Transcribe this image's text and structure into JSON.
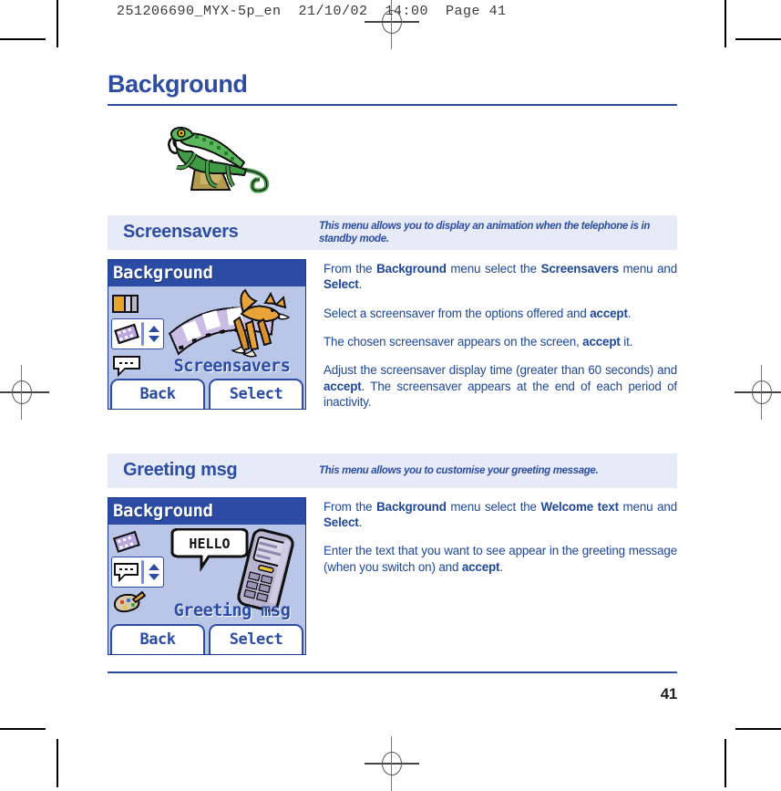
{
  "print_marks": {
    "slug_line": "251206690_MYX-5p_en  21/10/02  14:00  Page 41"
  },
  "page": {
    "title": "Background",
    "page_number": "41",
    "illustration": "chameleon-illustration"
  },
  "sections": [
    {
      "id": "screensavers",
      "heading": "Screensavers",
      "description": "This menu allows you to display an animation when the telephone is in standby mode.",
      "mockup": {
        "title": "Background",
        "caption": "Screensavers",
        "softkey_left": "Back",
        "softkey_right": "Select",
        "rail_icons": [
          "wallpaper-icon",
          "filmstrip-icon",
          "speech-bubble-icon"
        ],
        "selected_icon": "filmstrip-icon",
        "artwork": "fox-on-filmstrip-illustration"
      },
      "paragraphs": [
        [
          {
            "t": "From the "
          },
          {
            "t": "Background",
            "b": true
          },
          {
            "t": " menu select the "
          },
          {
            "t": "Screensavers",
            "b": true
          },
          {
            "t": " menu and "
          },
          {
            "t": "Select",
            "b": true
          },
          {
            "t": "."
          }
        ],
        [
          {
            "t": "Select a screensaver from the options offered and "
          },
          {
            "t": "accept",
            "b": true
          },
          {
            "t": "."
          }
        ],
        [
          {
            "t": "The chosen screensaver appears on the screen, "
          },
          {
            "t": "accept",
            "b": true
          },
          {
            "t": " it."
          }
        ],
        [
          {
            "t": "Adjust the screensaver display time (greater than 60 seconds) and "
          },
          {
            "t": "accept",
            "b": true
          },
          {
            "t": ". The screensaver appears at the end of each period of inactivity."
          }
        ]
      ]
    },
    {
      "id": "greeting-msg",
      "heading": "Greeting msg",
      "description": "This menu allows you to customise your greeting message.",
      "mockup": {
        "title": "Background",
        "caption": "Greeting msg",
        "softkey_left": "Back",
        "softkey_right": "Select",
        "rail_icons": [
          "filmstrip-icon",
          "speech-bubble-icon",
          "paint-palette-icon"
        ],
        "selected_icon": "speech-bubble-icon",
        "artwork": "phone-with-hello-bubble-illustration",
        "artwork_text": "HELLO"
      },
      "paragraphs": [
        [
          {
            "t": "From the "
          },
          {
            "t": "Background",
            "b": true
          },
          {
            "t": " menu select the "
          },
          {
            "t": "Welcome text",
            "b": true
          },
          {
            "t": " menu and "
          },
          {
            "t": "Select",
            "b": true
          },
          {
            "t": "."
          }
        ],
        [
          {
            "t": "Enter the text that you want to see appear in the greeting message (when you switch on) and "
          },
          {
            "t": "accept",
            "b": true
          },
          {
            "t": "."
          }
        ]
      ]
    }
  ],
  "colors": {
    "brand_blue": "#2d4da3",
    "body_blue": "#1d4699",
    "band_bg": "#e7ebf7",
    "screen_bg": "#b9c6e8",
    "titlebar_bg": "#2b4ba5",
    "page_number": "#231f20"
  }
}
